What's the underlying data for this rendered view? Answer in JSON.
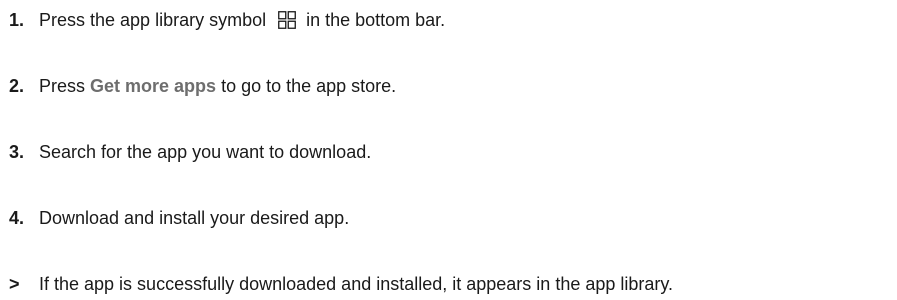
{
  "steps": [
    {
      "number": "1.",
      "before": "Press the app library symbol",
      "icon": "app-library-icon",
      "after": "in the bottom bar."
    },
    {
      "number": "2.",
      "before": "Press",
      "ui_term": "Get more apps",
      "after": "to go to the app store."
    },
    {
      "number": "3.",
      "text": "Search for the app you want to download."
    },
    {
      "number": "4.",
      "text": "Download and install your desired app."
    }
  ],
  "result": {
    "marker": ">",
    "text": "If the app is successfully downloaded and installed, it appears in the app library."
  },
  "colors": {
    "text": "#1a1a1a",
    "ui_term": "#6e6e6e"
  }
}
